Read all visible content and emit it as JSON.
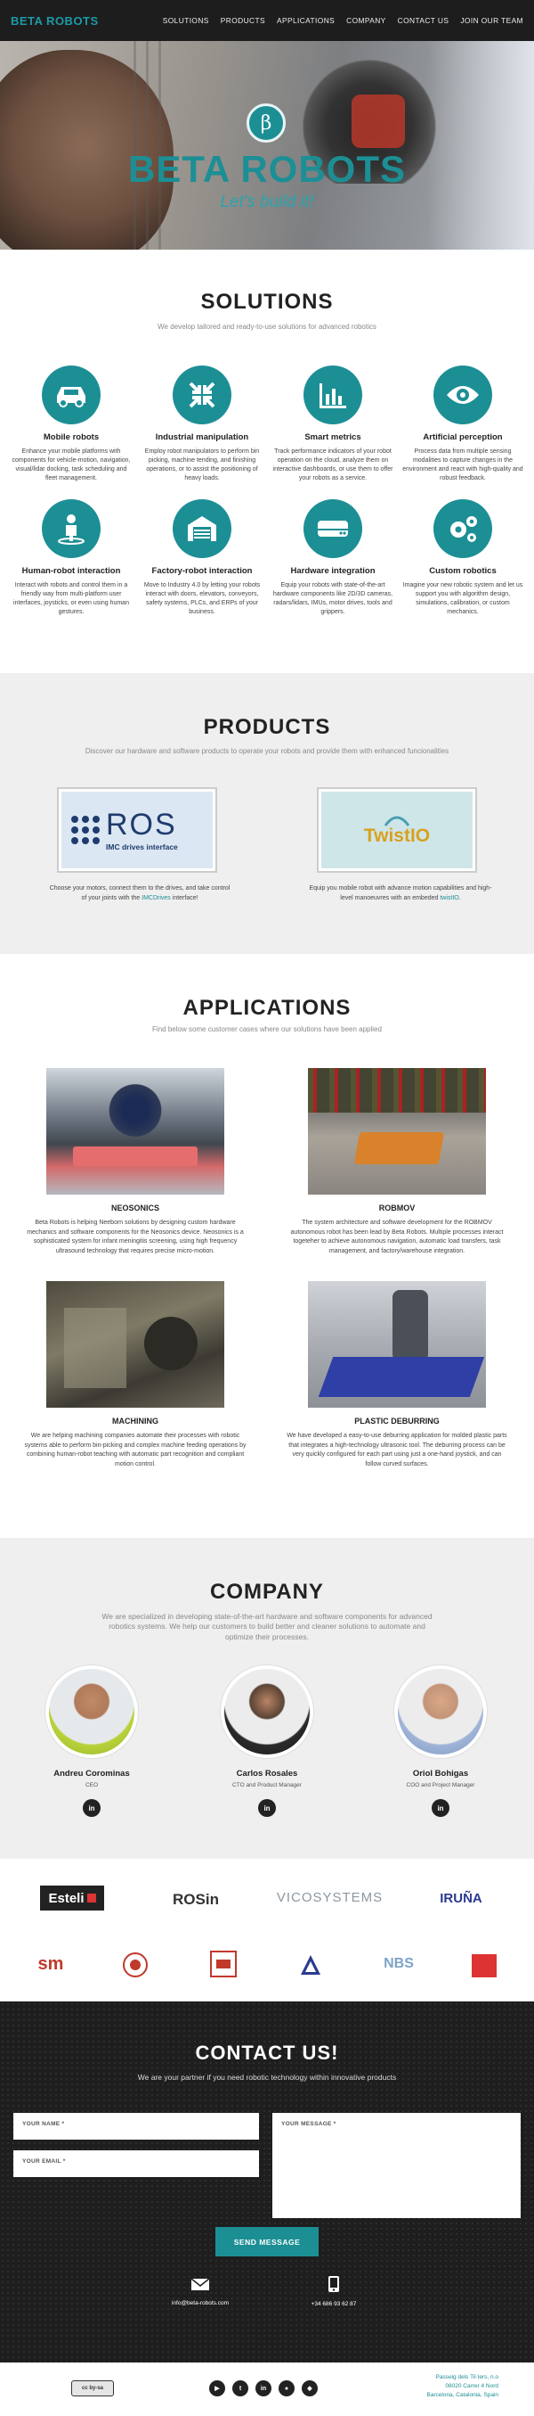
{
  "nav": {
    "logo": "BETA ROBOTS",
    "items": [
      "SOLUTIONS",
      "PRODUCTS",
      "APPLICATIONS",
      "COMPANY",
      "CONTACT US",
      "JOIN OUR TEAM"
    ]
  },
  "hero": {
    "badge": "β",
    "title": "BETA ROBOTS",
    "tagline": "Let's build it!"
  },
  "solutions": {
    "title": "SOLUTIONS",
    "subtitle": "We develop tailored and ready-to-use solutions for advanced robotics",
    "items": [
      {
        "icon": "car-icon",
        "title": "Mobile robots",
        "text": "Enhance your mobile platforms with components for vehicle-motion, navigation, visual/lidar docking, task scheduling and fleet management."
      },
      {
        "icon": "arrows-icon",
        "title": "Industrial manipulation",
        "text": "Employ robot manipulators to perform bin picking, machine tending, and finishing operations, or to assist the positioning of heavy loads."
      },
      {
        "icon": "bar-chart-icon",
        "title": "Smart metrics",
        "text": "Track performance indicators of your robot operation on the cloud, analyze them on interactive dashboards, or use them to offer your robots as a service."
      },
      {
        "icon": "eye-icon",
        "title": "Artificial perception",
        "text": "Process data from multiple sensing modalities to capture changes in the environment and react with high-quality and robust feedback."
      },
      {
        "icon": "person-icon",
        "title": "Human-robot interaction",
        "text": "Interact with robots and control them in a friendly way from multi-platform user interfaces, joysticks, or even using human gestures."
      },
      {
        "icon": "factory-icon",
        "title": "Factory-robot interaction",
        "text": "Move to Industry 4.0 by letting your robots interact with doors, elevators, conveyors, safety systems, PLCs, and ERPs of your business."
      },
      {
        "icon": "hdd-icon",
        "title": "Hardware integration",
        "text": "Equip your robots with state-of-the-art hardware components like 2D/3D cameras, radars/lidars, IMUs, motor drives, tools and grippers."
      },
      {
        "icon": "cogs-icon",
        "title": "Custom robotics",
        "text": "Imagine your new robotic system and let us support you with algorithm design, simulations, calibration, or custom mechanics."
      }
    ]
  },
  "products": {
    "title": "PRODUCTS",
    "subtitle": "Discover our hardware and software products to operate your robots and provide them with enhanced funcionalities",
    "items": [
      {
        "logo_text": "ROS",
        "logo_sub": "IMC drives interface",
        "text_before": "Choose your motors, connect them to the drives, and take control of your joints with the ",
        "link": "IMCDrives",
        "text_after": " interface!"
      },
      {
        "logo_text": "TwistIO",
        "text_before": "Equip you mobile robot with advance motion capabilities and high-level manoeuvres with an embeded ",
        "link": "twistIO",
        "text_after": "."
      }
    ]
  },
  "applications": {
    "title": "APPLICATIONS",
    "subtitle": "Find below some customer cases where our solutions have been applied",
    "items": [
      {
        "title": "NEOSONICS",
        "text": "Beta Robots is helping Neeborn solutions by designing custom hardware mechanics and software components for the Neosonics device. Neosonics is a sophisticated system for infant meningitis screening, using high frequency ultrasound technology that requires precise micro-motion."
      },
      {
        "title": "ROBMOV",
        "text": "The system architecture and software development for the ROBMOV autonomous robot has been lead by Beta Robots. Multiple processes interact togeteher to achieve autonomous navigation, automatic load transfers, task management, and factory/warehouse integration."
      },
      {
        "title": "MACHINING",
        "text": "We are helping machining companies automate their processes with robotic systems able to perform bin-picking and complex machine feeding operations by combining human-robot teaching with automatic part recognition and compliant motion control."
      },
      {
        "title": "PLASTIC DEBURRING",
        "text": "We have developed a easy-to-use deburring application for molded plastic parts that integrates a high-technology ultrasonic tool. The deburring process can be very quickly configured for each part using just a one-hand joystick, and can follow curved surfaces."
      }
    ]
  },
  "company": {
    "title": "COMPANY",
    "subtitle": "We are specialized in developing state-of-the-art hardware and software components for advanced robotics systems. We help our customers to build better and cleaner solutions to automate and optimize their processes.",
    "members": [
      {
        "name": "Andreu Corominas",
        "role": "CEO"
      },
      {
        "name": "Carlos Rosales",
        "role": "CTO and Product Manager"
      },
      {
        "name": "Oriol Bohigas",
        "role": "COO and Project Manager"
      }
    ],
    "linkedin": "in"
  },
  "partners": {
    "row1": [
      "Esteli",
      "ROSin",
      "VICOSYSTEMS",
      "IRUÑA"
    ],
    "row2": [
      "sm",
      "NBS"
    ]
  },
  "contact": {
    "title": "CONTACT US!",
    "subtitle": "We are your partner if you need robotic technology within innovative products",
    "name_label": "YOUR NAME *",
    "email_label": "YOUR EMAIL *",
    "message_label": "YOUR MESSAGE *",
    "send": "SEND MESSAGE",
    "email": "info@beta-robots.com",
    "phone": "+34 686 93 62 87"
  },
  "footer": {
    "cc": "cc by-sa",
    "address": [
      "Passeig dels Til·lers, n.o",
      "08020 Carrer 4 Nord",
      "Barcelona, Catalonia, Spain"
    ],
    "socials": [
      "youtube-icon",
      "twitter-icon",
      "linkedin-icon",
      "github-icon",
      "gitlab-icon"
    ]
  },
  "colors": {
    "accent": "#1c8f95",
    "dark": "#1e1e1e",
    "grey": "#efefef"
  }
}
